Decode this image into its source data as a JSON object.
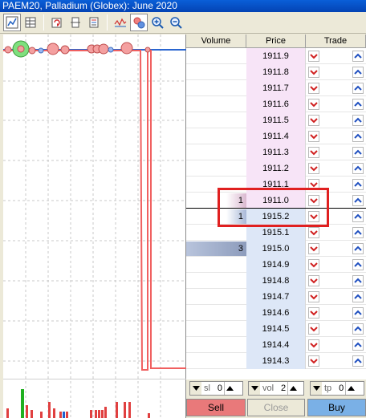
{
  "window": {
    "title": "PAEM20, Palladium (Globex): June 2020"
  },
  "toolbar": {
    "buttons": [
      {
        "name": "chart-toggle-icon",
        "pressed": true
      },
      {
        "name": "table-icon",
        "pressed": false
      },
      {
        "name": "refresh-icon",
        "pressed": false
      },
      {
        "name": "center-icon",
        "pressed": false
      },
      {
        "name": "levels-icon",
        "pressed": false
      },
      {
        "name": "ticks-icon",
        "pressed": false
      },
      {
        "name": "bubbles-icon",
        "pressed": true
      },
      {
        "name": "zoom-in-icon",
        "pressed": false
      },
      {
        "name": "zoom-out-icon",
        "pressed": false
      }
    ]
  },
  "ladder": {
    "headers": {
      "volume": "Volume",
      "price": "Price",
      "trade": "Trade"
    },
    "rows": [
      {
        "price": "1911.9",
        "volume": "",
        "side": "ask"
      },
      {
        "price": "1911.8",
        "volume": "",
        "side": "ask"
      },
      {
        "price": "1911.7",
        "volume": "",
        "side": "ask"
      },
      {
        "price": "1911.6",
        "volume": "",
        "side": "ask"
      },
      {
        "price": "1911.5",
        "volume": "",
        "side": "ask"
      },
      {
        "price": "1911.4",
        "volume": "",
        "side": "ask"
      },
      {
        "price": "1911.3",
        "volume": "",
        "side": "ask"
      },
      {
        "price": "1911.2",
        "volume": "",
        "side": "ask"
      },
      {
        "price": "1911.1",
        "volume": "",
        "side": "ask"
      },
      {
        "price": "1911.0",
        "volume": "1",
        "side": "ask"
      },
      {
        "price": "1915.2",
        "volume": "1",
        "side": "bid"
      },
      {
        "price": "1915.1",
        "volume": "",
        "side": "bid"
      },
      {
        "price": "1915.0",
        "volume": "3",
        "side": "bid"
      },
      {
        "price": "1914.9",
        "volume": "",
        "side": "bid"
      },
      {
        "price": "1914.8",
        "volume": "",
        "side": "bid"
      },
      {
        "price": "1914.7",
        "volume": "",
        "side": "bid"
      },
      {
        "price": "1914.6",
        "volume": "",
        "side": "bid"
      },
      {
        "price": "1914.5",
        "volume": "",
        "side": "bid"
      },
      {
        "price": "1914.4",
        "volume": "",
        "side": "bid"
      },
      {
        "price": "1914.3",
        "volume": "",
        "side": "bid"
      }
    ]
  },
  "controls": {
    "sl": {
      "label": "sl",
      "value": "0"
    },
    "vol": {
      "label": "vol",
      "value": "2"
    },
    "tp": {
      "label": "tp",
      "value": "0"
    },
    "sell_label": "Sell",
    "close_label": "Close",
    "buy_label": "Buy"
  },
  "colors": {
    "ask_bg": "#f7e4f7",
    "bid_bg": "#dde7f7",
    "sell": "#e9797a",
    "buy": "#7ab0e6",
    "highlight": "#e02020",
    "price_line": "#f06060",
    "ask_line": "#2a66d0"
  }
}
